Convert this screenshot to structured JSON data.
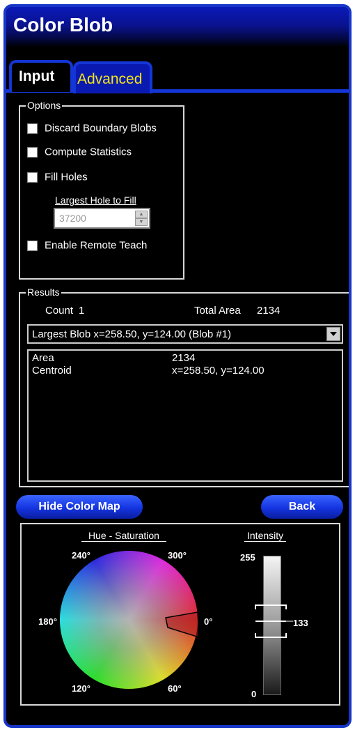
{
  "window": {
    "title": "Color Blob"
  },
  "tabs": [
    {
      "label": "Input",
      "active": false
    },
    {
      "label": "Advanced",
      "active": true
    }
  ],
  "options": {
    "title": "Options",
    "discard_boundary": "Discard Boundary Blobs",
    "compute_stats": "Compute Statistics",
    "fill_holes": "Fill Holes",
    "largest_hole_label": "Largest Hole to Fill",
    "largest_hole_value": "37200",
    "enable_remote_teach": "Enable Remote Teach"
  },
  "results": {
    "title": "Results",
    "count_label": "Count",
    "count_value": "1",
    "total_area_label": "Total Area",
    "total_area_value": "2134",
    "dropdown_selected": "Largest Blob  x=258.50, y=124.00  (Blob #1)",
    "list": [
      {
        "name": "Area",
        "value": "2134"
      },
      {
        "name": "Centroid",
        "value": "x=258.50, y=124.00"
      }
    ]
  },
  "buttons": {
    "hide_color_map": "Hide Color Map",
    "back": "Back"
  },
  "color_map": {
    "hue_sat_label": "Hue - Saturation",
    "intensity_label": "Intensity",
    "degrees": {
      "d240": "240°",
      "d300": "300°",
      "d180": "180°",
      "d0": "0°",
      "d120": "120°",
      "d60": "60°"
    },
    "intensity_max": "255",
    "intensity_min": "0",
    "intensity_value": "133"
  },
  "colors": {
    "accent_blue": "#1436d6",
    "tab_active_text": "#f3e51a"
  }
}
